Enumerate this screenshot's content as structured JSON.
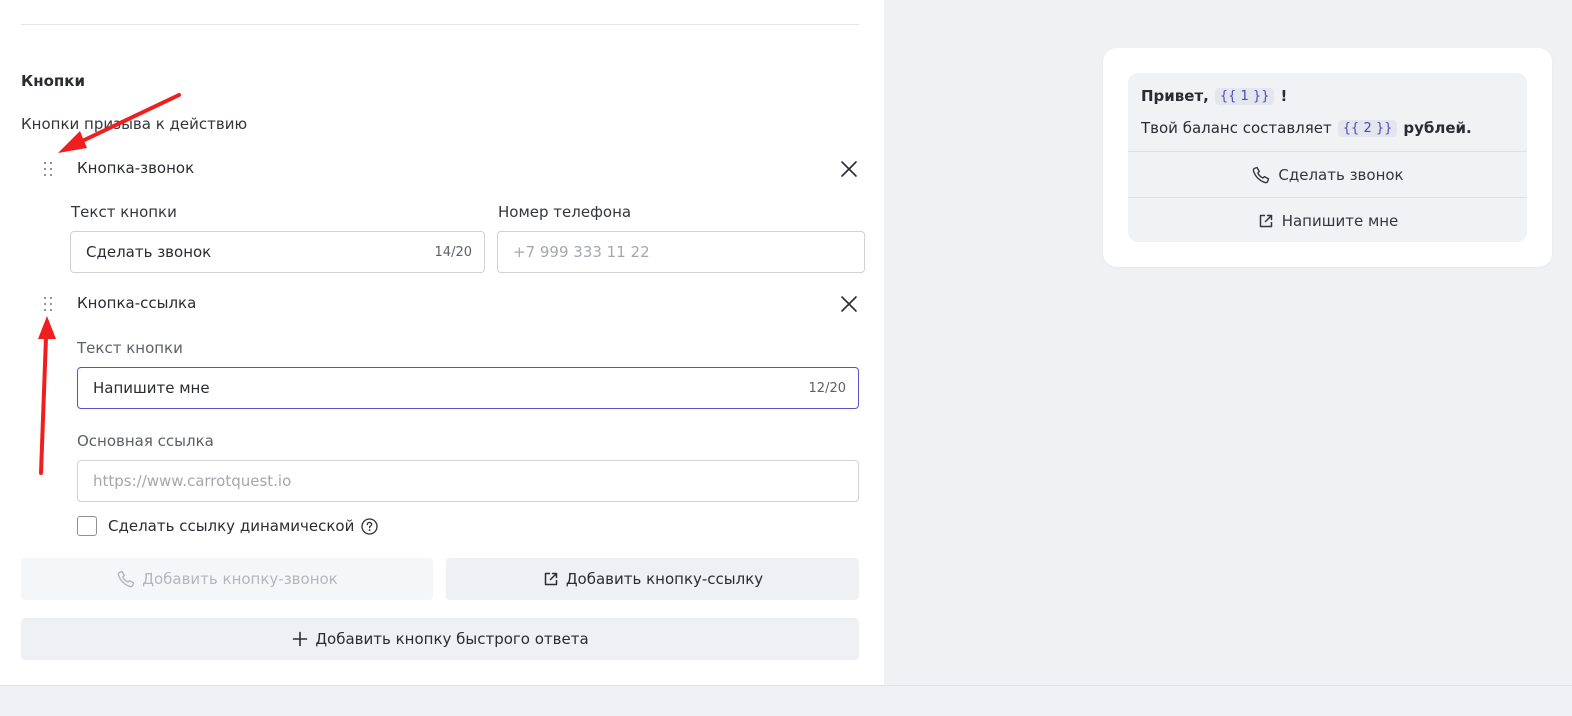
{
  "section": {
    "title": "Кнопки",
    "subtitle": "Кнопки призыва к действию"
  },
  "call_button": {
    "title": "Кнопка-звонок",
    "text_label": "Текст кнопки",
    "text_value": "Сделать звонок",
    "text_counter": "14/20",
    "phone_label": "Номер телефона",
    "phone_placeholder": "+7 999 333 11 22"
  },
  "link_button": {
    "title": "Кнопка-ссылка",
    "text_label": "Текст кнопки",
    "text_value": "Напишите мне",
    "text_counter": "12/20",
    "url_label": "Основная ссылка",
    "url_placeholder": "https://www.carrotquest.io",
    "dynamic_label": "Сделать ссылку динамической",
    "dynamic_checked": false
  },
  "actions": {
    "add_call": "Добавить кнопку-звонок",
    "add_link": "Добавить кнопку-ссылку",
    "add_quick_reply": "Добавить кнопку быстрого ответа"
  },
  "preview": {
    "greeting": "Привет,",
    "var1": "{{ 1 }}",
    "exclaim": "!",
    "balance_text": "Твой баланс составляет",
    "var2": "{{ 2 }}",
    "currency": "рублей.",
    "call_button": "Сделать звонок",
    "link_button": "Напишите мне"
  },
  "colors": {
    "accent": "#5a50c8",
    "annotation_arrow": "#f01e1e",
    "variable": "#4b48b8"
  }
}
